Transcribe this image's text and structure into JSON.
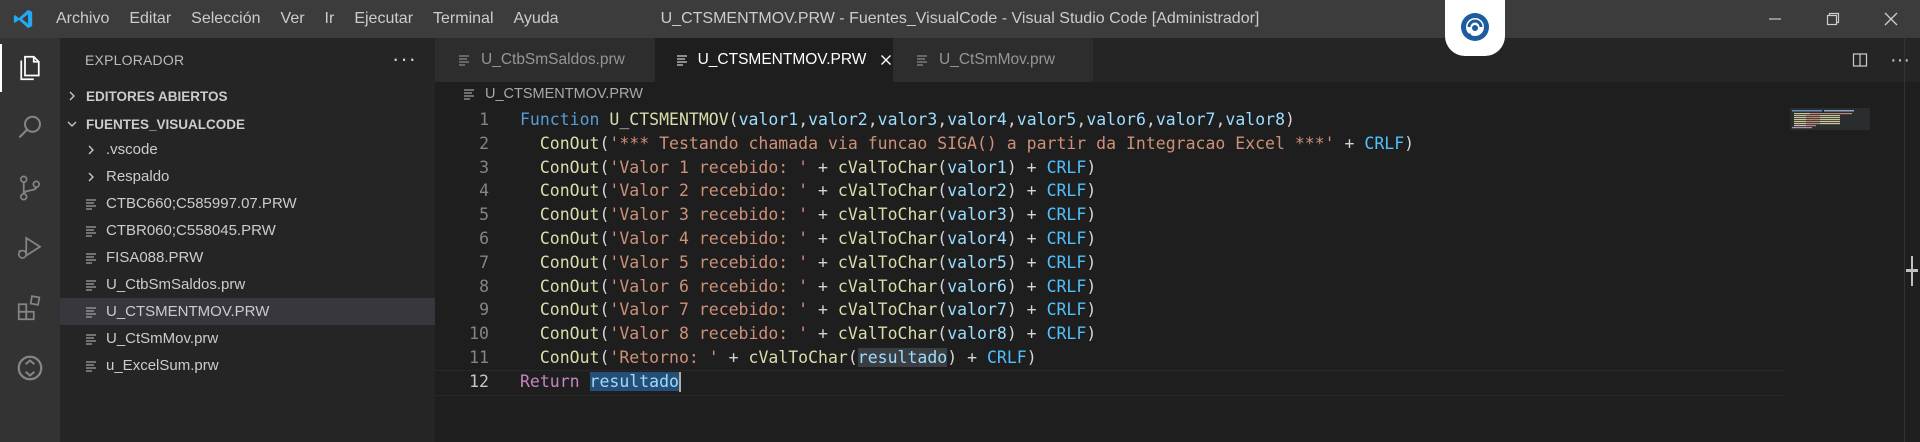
{
  "titlebar": {
    "menu": [
      "Archivo",
      "Editar",
      "Selección",
      "Ver",
      "Ir",
      "Ejecutar",
      "Terminal",
      "Ayuda"
    ],
    "title": "U_CTSMENTMOV.PRW - Fuentes_VisualCode - Visual Studio Code [Administrador]"
  },
  "sidebar": {
    "header": "EXPLORADOR",
    "open_editors": "EDITORES ABIERTOS",
    "workspace": "FUENTES_VISUALCODE",
    "items": [
      {
        "label": ".vscode",
        "type": "folder"
      },
      {
        "label": "Respaldo",
        "type": "folder"
      },
      {
        "label": "CTBC660;C585997.07.PRW",
        "type": "file"
      },
      {
        "label": "CTBR060;C558045.PRW",
        "type": "file"
      },
      {
        "label": "FISA088.PRW",
        "type": "file"
      },
      {
        "label": "U_CtbSmSaldos.prw",
        "type": "file"
      },
      {
        "label": "U_CTSMENTMOV.PRW",
        "type": "file",
        "active": true
      },
      {
        "label": "U_CtSmMov.prw",
        "type": "file"
      },
      {
        "label": "u_ExcelSum.prw",
        "type": "file"
      }
    ]
  },
  "tabs": [
    {
      "label": "U_CtbSmSaldos.prw",
      "active": false
    },
    {
      "label": "U_CTSMENTMOV.PRW",
      "active": true
    },
    {
      "label": "U_CtSmMov.prw",
      "active": false
    }
  ],
  "breadcrumb": "U_CTSMENTMOV.PRW",
  "editor": {
    "cursor_line": 12,
    "lines": [
      {
        "n": "1",
        "tokens": [
          [
            "kw-fn",
            "Function"
          ],
          [
            "op",
            " "
          ],
          [
            "fn",
            "U_CTSMENTMOV"
          ],
          [
            "op",
            "("
          ],
          [
            "id",
            "valor1"
          ],
          [
            "op",
            ","
          ],
          [
            "id",
            "valor2"
          ],
          [
            "op",
            ","
          ],
          [
            "id",
            "valor3"
          ],
          [
            "op",
            ","
          ],
          [
            "id",
            "valor4"
          ],
          [
            "op",
            ","
          ],
          [
            "id",
            "valor5"
          ],
          [
            "op",
            ","
          ],
          [
            "id",
            "valor6"
          ],
          [
            "op",
            ","
          ],
          [
            "id",
            "valor7"
          ],
          [
            "op",
            ","
          ],
          [
            "id",
            "valor8"
          ],
          [
            "op",
            ")"
          ]
        ]
      },
      {
        "n": "2",
        "tokens": [
          [
            "op",
            "  "
          ],
          [
            "fn",
            "ConOut"
          ],
          [
            "op",
            "("
          ],
          [
            "str",
            "'*** Testando chamada via funcao SIGA() a partir da Integracao Excel ***'"
          ],
          [
            "op",
            " + "
          ],
          [
            "const",
            "CRLF"
          ],
          [
            "op",
            ")"
          ]
        ]
      },
      {
        "n": "3",
        "tokens": [
          [
            "op",
            "  "
          ],
          [
            "fn",
            "ConOut"
          ],
          [
            "op",
            "("
          ],
          [
            "str",
            "'Valor 1 recebido: '"
          ],
          [
            "op",
            " + "
          ],
          [
            "fn",
            "cValToChar"
          ],
          [
            "op",
            "("
          ],
          [
            "id",
            "valor1"
          ],
          [
            "op",
            ") + "
          ],
          [
            "const",
            "CRLF"
          ],
          [
            "op",
            ")"
          ]
        ]
      },
      {
        "n": "4",
        "tokens": [
          [
            "op",
            "  "
          ],
          [
            "fn",
            "ConOut"
          ],
          [
            "op",
            "("
          ],
          [
            "str",
            "'Valor 2 recebido: '"
          ],
          [
            "op",
            " + "
          ],
          [
            "fn",
            "cValToChar"
          ],
          [
            "op",
            "("
          ],
          [
            "id",
            "valor2"
          ],
          [
            "op",
            ") + "
          ],
          [
            "const",
            "CRLF"
          ],
          [
            "op",
            ")"
          ]
        ]
      },
      {
        "n": "5",
        "tokens": [
          [
            "op",
            "  "
          ],
          [
            "fn",
            "ConOut"
          ],
          [
            "op",
            "("
          ],
          [
            "str",
            "'Valor 3 recebido: '"
          ],
          [
            "op",
            " + "
          ],
          [
            "fn",
            "cValToChar"
          ],
          [
            "op",
            "("
          ],
          [
            "id",
            "valor3"
          ],
          [
            "op",
            ") + "
          ],
          [
            "const",
            "CRLF"
          ],
          [
            "op",
            ")"
          ]
        ]
      },
      {
        "n": "6",
        "tokens": [
          [
            "op",
            "  "
          ],
          [
            "fn",
            "ConOut"
          ],
          [
            "op",
            "("
          ],
          [
            "str",
            "'Valor 4 recebido: '"
          ],
          [
            "op",
            " + "
          ],
          [
            "fn",
            "cValToChar"
          ],
          [
            "op",
            "("
          ],
          [
            "id",
            "valor4"
          ],
          [
            "op",
            ") + "
          ],
          [
            "const",
            "CRLF"
          ],
          [
            "op",
            ")"
          ]
        ]
      },
      {
        "n": "7",
        "tokens": [
          [
            "op",
            "  "
          ],
          [
            "fn",
            "ConOut"
          ],
          [
            "op",
            "("
          ],
          [
            "str",
            "'Valor 5 recebido: '"
          ],
          [
            "op",
            " + "
          ],
          [
            "fn",
            "cValToChar"
          ],
          [
            "op",
            "("
          ],
          [
            "id",
            "valor5"
          ],
          [
            "op",
            ") + "
          ],
          [
            "const",
            "CRLF"
          ],
          [
            "op",
            ")"
          ]
        ]
      },
      {
        "n": "8",
        "tokens": [
          [
            "op",
            "  "
          ],
          [
            "fn",
            "ConOut"
          ],
          [
            "op",
            "("
          ],
          [
            "str",
            "'Valor 6 recebido: '"
          ],
          [
            "op",
            " + "
          ],
          [
            "fn",
            "cValToChar"
          ],
          [
            "op",
            "("
          ],
          [
            "id",
            "valor6"
          ],
          [
            "op",
            ") + "
          ],
          [
            "const",
            "CRLF"
          ],
          [
            "op",
            ")"
          ]
        ]
      },
      {
        "n": "9",
        "tokens": [
          [
            "op",
            "  "
          ],
          [
            "fn",
            "ConOut"
          ],
          [
            "op",
            "("
          ],
          [
            "str",
            "'Valor 7 recebido: '"
          ],
          [
            "op",
            " + "
          ],
          [
            "fn",
            "cValToChar"
          ],
          [
            "op",
            "("
          ],
          [
            "id",
            "valor7"
          ],
          [
            "op",
            ") + "
          ],
          [
            "const",
            "CRLF"
          ],
          [
            "op",
            ")"
          ]
        ]
      },
      {
        "n": "10",
        "tokens": [
          [
            "op",
            "  "
          ],
          [
            "fn",
            "ConOut"
          ],
          [
            "op",
            "("
          ],
          [
            "str",
            "'Valor 8 recebido: '"
          ],
          [
            "op",
            " + "
          ],
          [
            "fn",
            "cValToChar"
          ],
          [
            "op",
            "("
          ],
          [
            "id",
            "valor8"
          ],
          [
            "op",
            ") + "
          ],
          [
            "const",
            "CRLF"
          ],
          [
            "op",
            ")"
          ]
        ]
      },
      {
        "n": "11",
        "tokens": [
          [
            "op",
            "  "
          ],
          [
            "fn",
            "ConOut"
          ],
          [
            "op",
            "("
          ],
          [
            "str",
            "'Retorno: '"
          ],
          [
            "op",
            " + "
          ],
          [
            "fn",
            "cValToChar"
          ],
          [
            "op",
            "("
          ],
          [
            "id hl2",
            "resultado"
          ],
          [
            "op",
            ") + "
          ],
          [
            "const",
            "CRLF"
          ],
          [
            "op",
            ")"
          ]
        ]
      },
      {
        "n": "12",
        "tokens": [
          [
            "kw-ret",
            "Return"
          ],
          [
            "op",
            " "
          ],
          [
            "id hl",
            "resultado"
          ]
        ]
      }
    ]
  },
  "colors": {
    "titlebar": "#3c3c3c",
    "activitybar": "#333333",
    "sidebar": "#252526",
    "editor": "#1e1e1e",
    "accent": "#007acc"
  }
}
